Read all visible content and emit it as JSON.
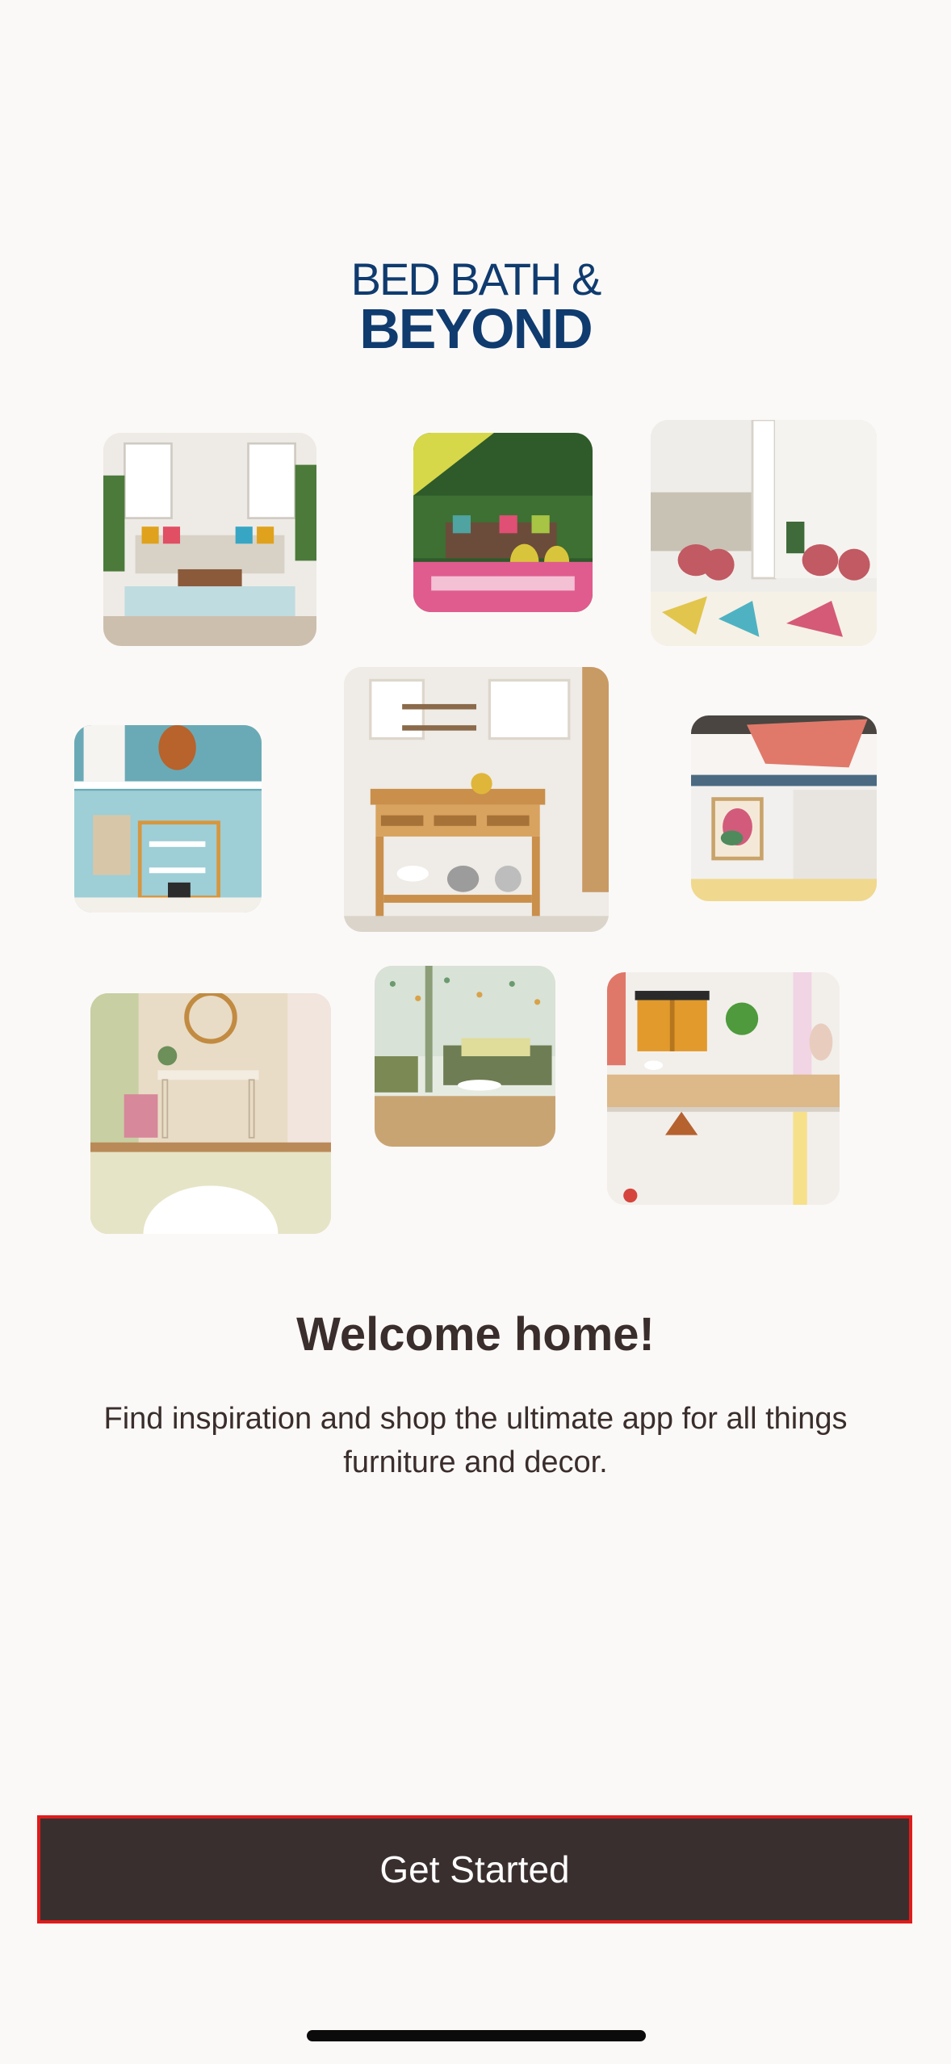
{
  "logo": {
    "line1": "BED BATH &",
    "line2": "BEYOND"
  },
  "gallery": {
    "images": [
      "living-room-photo",
      "patio-photo",
      "dining-room-photo",
      "home-office-photo",
      "kitchen-island-photo",
      "bedroom-photo",
      "entryway-photo",
      "sitting-room-photo",
      "bathroom-vanity-photo"
    ]
  },
  "welcome": {
    "title": "Welcome home!",
    "subtitle": "Find inspiration and shop the ultimate app for all things furniture and decor."
  },
  "cta": {
    "label": "Get Started"
  },
  "colors": {
    "background": "#FBF9F7",
    "logo": "#0F3B6F",
    "text": "#3A2E2C",
    "button": "#3A2F2F",
    "button_outline": "#E01B1B"
  }
}
